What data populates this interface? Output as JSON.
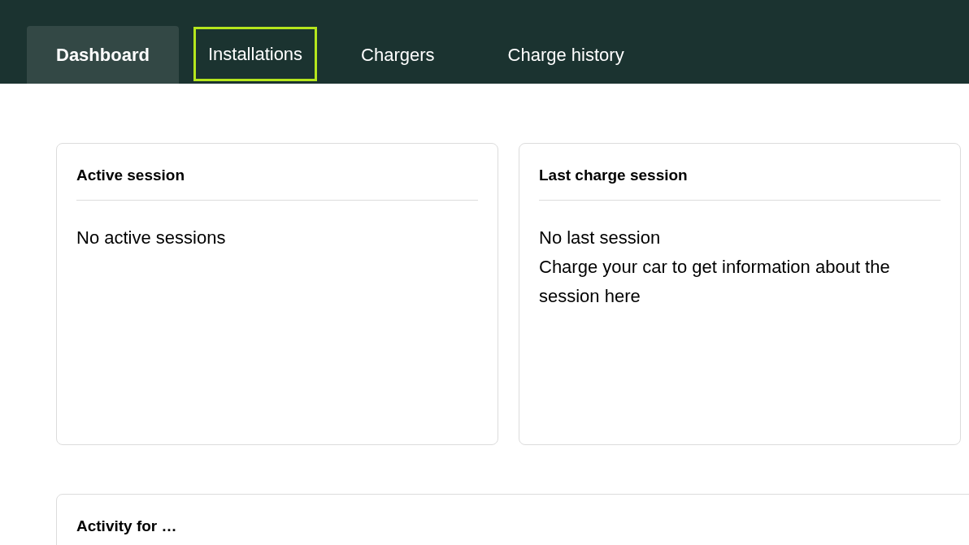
{
  "tabs": [
    {
      "label": "Dashboard",
      "selected": true,
      "focused": false
    },
    {
      "label": "Installations",
      "selected": false,
      "focused": true
    },
    {
      "label": "Chargers",
      "selected": false,
      "focused": false
    },
    {
      "label": "Charge history",
      "selected": false,
      "focused": false
    }
  ],
  "cards": [
    {
      "title": "Active session",
      "lines": [
        "No active sessions"
      ]
    },
    {
      "title": "Last charge session",
      "lines": [
        "No last session",
        "Charge your car to get information about the session here"
      ]
    }
  ],
  "activity": {
    "title": "Activity for …"
  }
}
